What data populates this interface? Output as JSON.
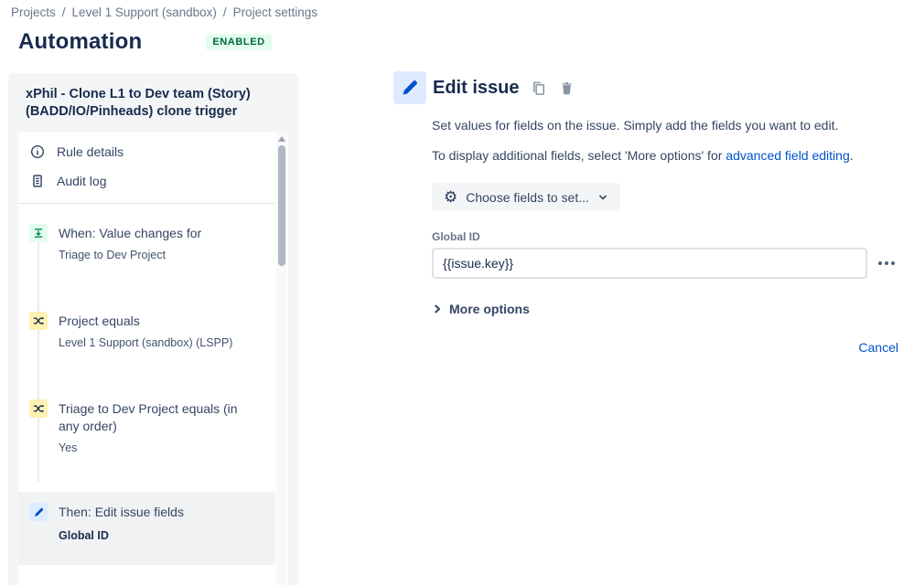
{
  "breadcrumb": {
    "separator": "/",
    "items": [
      "Projects",
      "Level 1 Support (sandbox)",
      "Project settings"
    ]
  },
  "header": {
    "title": "Automation",
    "status_badge": "ENABLED"
  },
  "sidebar": {
    "rule_title": "xPhil - Clone L1 to Dev team (Story) (BADD/IO/Pinheads) clone trigger",
    "nav": [
      {
        "label": "Rule details",
        "icon": "info-icon"
      },
      {
        "label": "Audit log",
        "icon": "audit-log-icon"
      }
    ],
    "steps": [
      {
        "title": "When: Value changes for",
        "subtitle": "Triage to Dev Project",
        "icon": "trigger-icon",
        "icon_bg": "#e3fcef",
        "icon_color": "#00875a",
        "selected": false
      },
      {
        "title": "Project equals",
        "subtitle": "Level 1 Support (sandbox) (LSPP)",
        "icon": "condition-shuffle-icon",
        "icon_bg": "#fff0b3",
        "icon_color": "#172b4d",
        "selected": false
      },
      {
        "title": "Triage to Dev Project equals (in any order)",
        "subtitle": "Yes",
        "icon": "condition-shuffle-icon",
        "icon_bg": "#fff0b3",
        "icon_color": "#172b4d",
        "selected": false
      },
      {
        "title": "Then: Edit issue fields",
        "subtitle": "Global ID",
        "icon": "pencil-icon",
        "icon_bg": "#deebff",
        "icon_color": "#0052cc",
        "selected": true
      }
    ]
  },
  "main": {
    "title": "Edit issue",
    "description_1": "Set values for fields on the issue. Simply add the fields you want to edit.",
    "description_2_prefix": "To display additional fields, select 'More options' for ",
    "description_2_link": "advanced field editing",
    "description_2_suffix": ".",
    "choose_fields_button": "Choose fields to set...",
    "field": {
      "label": "Global ID",
      "value": "{{issue.key}}"
    },
    "more_options_label": "More options",
    "cancel_label": "Cancel"
  },
  "colors": {
    "heading_text": "#172b4d",
    "body_text": "#344563",
    "muted_text": "#6b778c",
    "link_blue": "#0052cc",
    "badge_bg": "#e3fcef",
    "badge_text": "#006644",
    "trigger_green": "#00875a",
    "condition_yellow_bg": "#fff0b3",
    "action_blue_bg": "#deebff",
    "sidebar_bg": "#f4f5f7",
    "selected_row_bg": "#f1f2f4",
    "border_gray": "#dfe1e6"
  }
}
